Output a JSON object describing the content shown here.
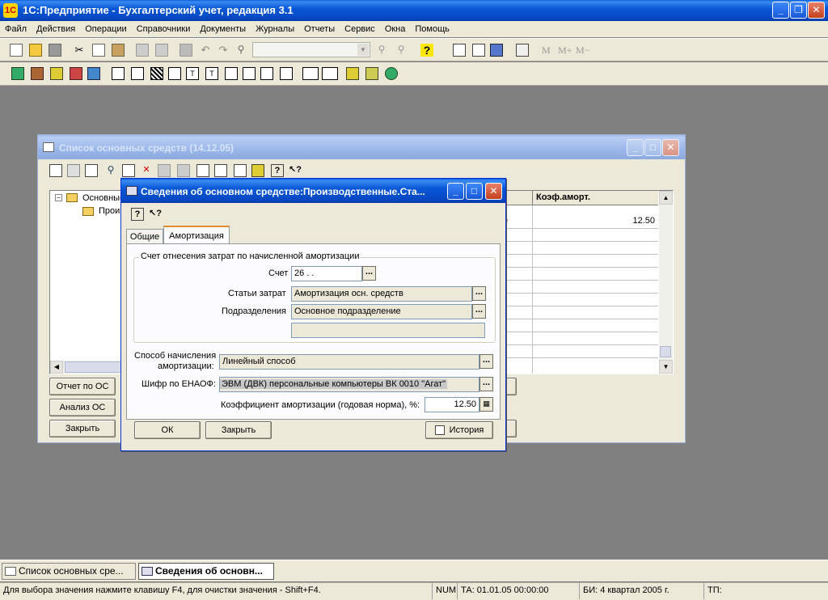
{
  "app": {
    "title": "1С:Предприятие - Бухгалтерский учет, редакция 3.1"
  },
  "menu": [
    "Файл",
    "Действия",
    "Операции",
    "Справочники",
    "Документы",
    "Журналы",
    "Отчеты",
    "Сервис",
    "Окна",
    "Помощь"
  ],
  "toolbar": {
    "memory_buttons": [
      "M",
      "M+",
      "M−"
    ]
  },
  "list_window": {
    "title": "Список основных средств (14.12.05)",
    "tree": [
      "Основные средства",
      "Производственные"
    ],
    "column_header": "Коэф.аморт.",
    "partial_text": "е",
    "value": "12.50",
    "buttons": {
      "report": "Отчет по ОС",
      "analysis": "Анализ ОС",
      "close": "Закрыть"
    }
  },
  "dialog": {
    "title": "Сведения об основном средстве:Производственные.Ста...",
    "tabs": [
      "Общие",
      "Амортизация"
    ],
    "group_title": "Счет отнесения затрат по начисленной амортизации",
    "account_label": "Счет",
    "account_value": "26 .  .",
    "cost_items_label": "Статьи затрат",
    "cost_items_value": "Амортизация осн. средств",
    "department_label": "Подразделения",
    "department_value": "Основное подразделение",
    "method_label_1": "Способ начисления",
    "method_label_2": "амортизации:",
    "method_value": "Линейный способ",
    "code_label": "Шифр по ЕНАОФ:",
    "code_value": "ЭВМ (ДВК) персональные компьютеры ВК 0010 \"Агат\"",
    "coef_label": "Коэффициент амортизации (годовая норма), %:",
    "coef_value": "12.50",
    "ok": "ОК",
    "close": "Закрыть",
    "history": "История"
  },
  "taskbar": {
    "items": [
      "Список основных сре...",
      "Сведения об основн..."
    ]
  },
  "statusbar": {
    "hint": "Для выбора значения нажмите клавишу F4, для очистки значения - Shift+F4.",
    "num": "NUM",
    "ta": "ТА: 01.01.05  00:00:00",
    "bi": "БИ: 4 квартал 2005 г.",
    "tp": "ТП:"
  }
}
